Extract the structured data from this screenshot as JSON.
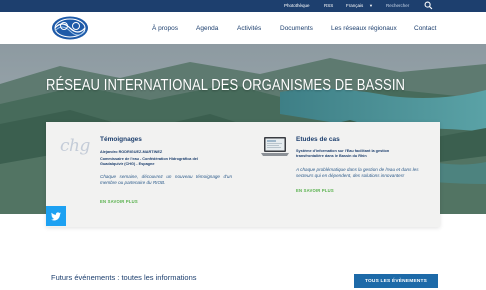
{
  "topbar": {
    "phototheque": "Photothèque",
    "rss": "RSS",
    "language": "Français",
    "search_placeholder": "Rechercher",
    "icons": [
      "caret-down-icon",
      "search-icon"
    ]
  },
  "nav": {
    "items": [
      "À propos",
      "Agenda",
      "Activités",
      "Documents",
      "Les réseaux régionaux",
      "Contact"
    ]
  },
  "hero": {
    "title": "RÉSEAU INTERNATIONAL DES ORGANISMES DE BASSIN"
  },
  "testimonials": {
    "heading": "Témoignages",
    "logo_text": "chg",
    "name": "Alejandro RODRIGUEZ-MARTINEZ",
    "role": "Commissaire de l'eau - Confédération Hidrográfica del Guadalquivir (CHG) - Espagne",
    "excerpt": "Chaque semaine, découvrez un nouveau témoignage d'un membre ou partenaire du RIOB.",
    "more": "EN SAVOIR PLUS"
  },
  "case_studies": {
    "heading": "Etudes de cas",
    "subtitle": "Système d'information sur l'Eau facilitant la gestion transfrontalière dans le Bassin du Rhin",
    "excerpt": "A chaque problématique dans la gestion de l'eau et dans les secteurs qui en dépendent, des solutions innovantes!",
    "more": "EN SAVOIR PLUS"
  },
  "events": {
    "title": "Futurs événements : toutes les informations",
    "button": "TOUS LES ÉVÈNEMENTS"
  },
  "colors": {
    "brand": "#1d3f6e",
    "accent_green": "#56b04a",
    "button_blue": "#1d6aa8",
    "twitter": "#1da1f2"
  }
}
